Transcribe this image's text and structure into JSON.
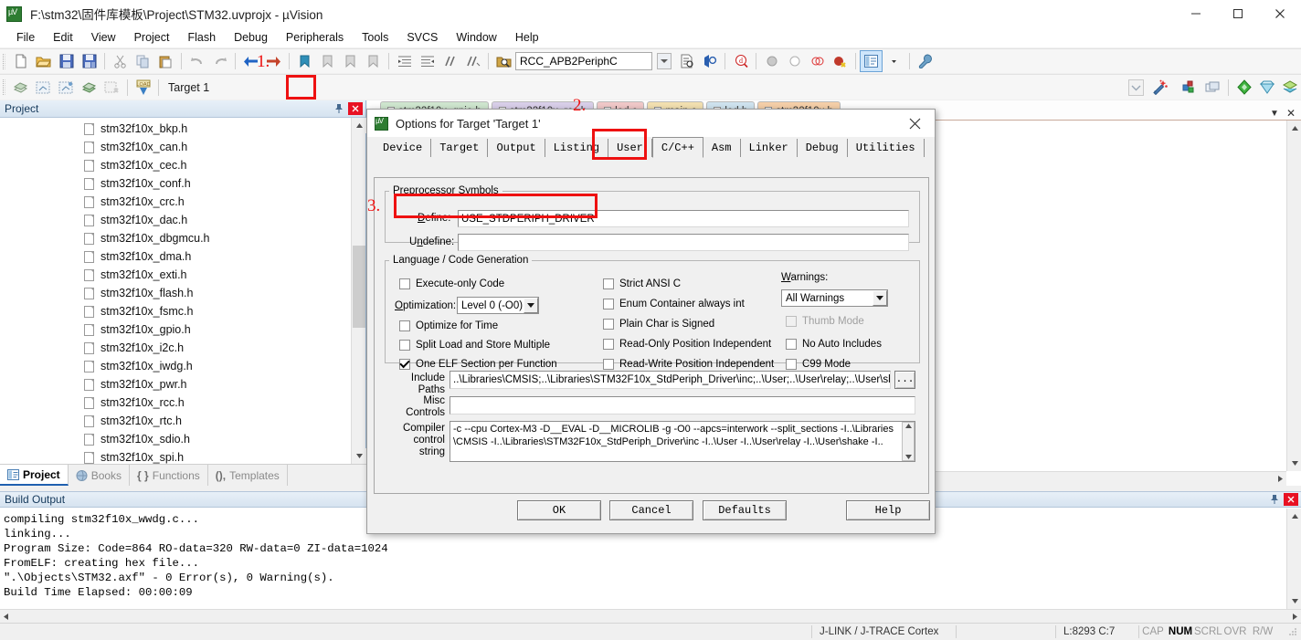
{
  "window": {
    "title": "F:\\stm32\\固件库模板\\Project\\STM32.uvprojx - µVision",
    "app_icon": "uvision-icon",
    "minimize": "─",
    "maximize": "☐",
    "close": "✕"
  },
  "menu": {
    "items": [
      "File",
      "Edit",
      "View",
      "Project",
      "Flash",
      "Debug",
      "Peripherals",
      "Tools",
      "SVCS",
      "Window",
      "Help"
    ]
  },
  "toolbar": {
    "target_label": "Target 1",
    "symbol_combo_value": "RCC_APB2PeriphC",
    "symbol_combo_arrow": "▼"
  },
  "project_panel": {
    "title": "Project",
    "pin_icon": "pin-icon",
    "close_icon": "close-icon",
    "files": [
      "stm32f10x_bkp.h",
      "stm32f10x_can.h",
      "stm32f10x_cec.h",
      "stm32f10x_conf.h",
      "stm32f10x_crc.h",
      "stm32f10x_dac.h",
      "stm32f10x_dbgmcu.h",
      "stm32f10x_dma.h",
      "stm32f10x_exti.h",
      "stm32f10x_flash.h",
      "stm32f10x_fsmc.h",
      "stm32f10x_gpio.h",
      "stm32f10x_i2c.h",
      "stm32f10x_iwdg.h",
      "stm32f10x_pwr.h",
      "stm32f10x_rcc.h",
      "stm32f10x_rtc.h",
      "stm32f10x_sdio.h",
      "stm32f10x_spi.h"
    ],
    "tabs": [
      {
        "label": "Project",
        "icon": "project-icon",
        "selected": true
      },
      {
        "label": "Books",
        "icon": "books-icon",
        "selected": false
      },
      {
        "label": "Functions",
        "icon": "functions-icon",
        "selected": false
      },
      {
        "label": "Templates",
        "icon": "templates-icon",
        "selected": false
      }
    ]
  },
  "editor": {
    "tabs": [
      {
        "label": "stm32f10x_gpio.h",
        "color": "#cfe6cf"
      },
      {
        "label": "stm32f10x_rcc.h",
        "color": "#d9cfe9"
      },
      {
        "label": "led.c",
        "color": "#f0c8c8"
      },
      {
        "label": "main.c",
        "color": "#f3e0b0"
      },
      {
        "label": "led.h",
        "color": "#cfe3ef"
      },
      {
        "label": "stm32f10x.h",
        "color": "#f5cfa8"
      }
    ],
    "dropdown_icon": "▼",
    "close_icon": "✕"
  },
  "dialog": {
    "title": "Options for Target 'Target 1'",
    "close_icon": "✕",
    "tabs": [
      "Device",
      "Target",
      "Output",
      "Listing",
      "User",
      "C/C++",
      "Asm",
      "Linker",
      "Debug",
      "Utilities"
    ],
    "selected_tab": "C/C++",
    "preprocessor": {
      "legend": "Preprocessor Symbols",
      "define_label": "Define:",
      "define_value": "USE_STDPERIPH_DRIVER",
      "undefine_label": "Undefine:",
      "undefine_value": ""
    },
    "language": {
      "legend": "Language / Code Generation",
      "left_checks": [
        {
          "label": "Execute-only Code",
          "checked": false,
          "disabled": false
        },
        {
          "label": "Optimize for Time",
          "checked": false,
          "disabled": false
        },
        {
          "label": "Split Load and Store Multiple",
          "checked": false,
          "disabled": false
        },
        {
          "label": "One ELF Section per Function",
          "checked": true,
          "disabled": false
        }
      ],
      "optimization_label": "Optimization:",
      "optimization_value": "Level 0 (-O0)",
      "mid_checks": [
        {
          "label": "Strict ANSI C",
          "checked": false,
          "disabled": false
        },
        {
          "label": "Enum Container always int",
          "checked": false,
          "disabled": false
        },
        {
          "label": "Plain Char is Signed",
          "checked": false,
          "disabled": false
        },
        {
          "label": "Read-Only Position Independent",
          "checked": false,
          "disabled": false
        },
        {
          "label": "Read-Write Position Independent",
          "checked": false,
          "disabled": false
        }
      ],
      "warnings_label": "Warnings:",
      "warnings_value": "All Warnings",
      "right_checks": [
        {
          "label": "Thumb Mode",
          "checked": false,
          "disabled": true
        },
        {
          "label": "No Auto Includes",
          "checked": false,
          "disabled": false
        },
        {
          "label": "C99 Mode",
          "checked": false,
          "disabled": false
        }
      ]
    },
    "paths": {
      "include_label_1": "Include",
      "include_label_2": "Paths",
      "include_value": "..\\Libraries\\CMSIS;..\\Libraries\\STM32F10x_StdPeriph_Driver\\inc;..\\User;..\\User\\relay;..\\User\\shake",
      "browse_label": "...",
      "misc_label_1": "Misc",
      "misc_label_2": "Controls",
      "misc_value": "",
      "compiler_label_1": "Compiler",
      "compiler_label_2": "control",
      "compiler_label_3": "string",
      "compiler_value": "-c --cpu Cortex-M3 -D__EVAL -D__MICROLIB -g -O0 --apcs=interwork --split_sections -I..\\Libraries\\CMSIS -I..\\Libraries\\STM32F10x_StdPeriph_Driver\\inc -I..\\User -I..\\User\\relay -I..\\User\\shake -I.."
    },
    "buttons": [
      "OK",
      "Cancel",
      "Defaults",
      "Help"
    ]
  },
  "build_output": {
    "title": "Build Output",
    "lines": [
      "compiling stm32f10x_wwdg.c...",
      "linking...",
      "Program Size: Code=864 RO-data=320 RW-data=0 ZI-data=1024",
      "FromELF: creating hex file...",
      "\".\\Objects\\STM32.axf\" - 0 Error(s), 0 Warning(s).",
      "Build Time Elapsed:  00:00:09"
    ],
    "pin_icon": "pin-icon",
    "close_icon": "close-icon"
  },
  "statusbar": {
    "debugger": "J-LINK / J-TRACE Cortex",
    "position": "L:8293 C:7",
    "indicators": [
      {
        "label": "CAP",
        "active": false
      },
      {
        "label": "NUM",
        "active": true
      },
      {
        "label": "SCRL",
        "active": false
      },
      {
        "label": "OVR",
        "active": false
      },
      {
        "label": "R/W",
        "active": false
      }
    ]
  },
  "annotations": [
    {
      "number": "1.",
      "target": "options-for-target-toolbar-button"
    },
    {
      "number": "2.",
      "target": "cpp-tab"
    },
    {
      "number": "3.",
      "target": "define-field"
    }
  ],
  "colors": {
    "annotation": "#ee1111",
    "panel_header": "#d6e3f0",
    "accent": "#2060b0"
  }
}
